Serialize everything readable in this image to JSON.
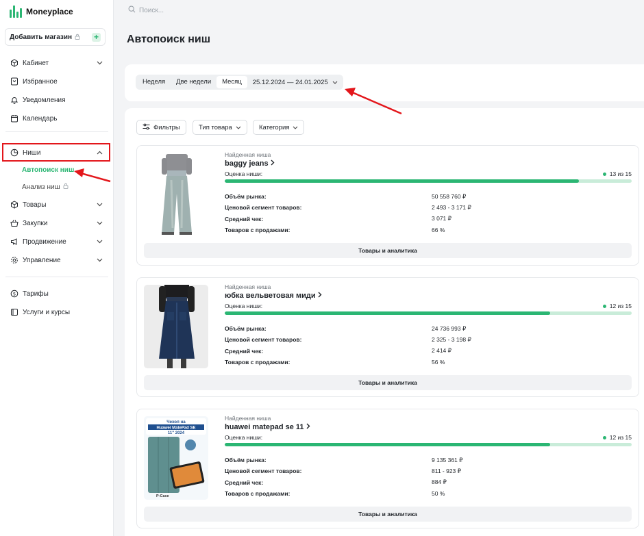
{
  "app": {
    "name": "Moneyplace"
  },
  "sidebar": {
    "add_store": "Добавить магазин",
    "items_top": [
      "Кабинет",
      "Избранное",
      "Уведомления",
      "Календарь"
    ],
    "niches": {
      "label": "Ниши",
      "sub": [
        "Автопоиск ниш",
        "Анализ ниш"
      ]
    },
    "items_mid": [
      "Товары",
      "Закупки",
      "Продвижение",
      "Управление"
    ],
    "items_bottom": [
      "Тарифы",
      "Услуги и курсы"
    ]
  },
  "search": {
    "placeholder": "Поиск..."
  },
  "page": {
    "title": "Автопоиск ниш"
  },
  "period": {
    "options": [
      "Неделя",
      "Две недели",
      "Месяц"
    ],
    "selected": "Месяц",
    "date_range": "25.12.2024 — 24.01.2025"
  },
  "filters": [
    "Фильтры",
    "Тип товара",
    "Категория"
  ],
  "card_labels": {
    "caption": "Найденная ниша",
    "score": "Оценка ниши:",
    "market": "Объём рынка:",
    "price_segment": "Ценовой сегмент товаров:",
    "avg_check": "Средний чек:",
    "with_sales": "Товаров с продажами:",
    "action": "Товары и аналитика"
  },
  "cards": [
    {
      "name": "baggy jeans",
      "score": "13 из 15",
      "score_fraction": 0.87,
      "market": "50 558 760 ₽",
      "price_segment": "2 493 - 3 171 ₽",
      "avg_check": "3 071 ₽",
      "with_sales": "66 %"
    },
    {
      "name": "юбка вельветовая миди",
      "score": "12 из 15",
      "score_fraction": 0.8,
      "market": "24 736 993 ₽",
      "price_segment": "2 325 - 3 198 ₽",
      "avg_check": "2 414 ₽",
      "with_sales": "56 %"
    },
    {
      "name": "huawei matepad se 11",
      "score": "12 из 15",
      "score_fraction": 0.8,
      "market": "9 135 361 ₽",
      "price_segment": "811 - 923 ₽",
      "avg_check": "884 ₽",
      "with_sales": "50 %"
    }
  ],
  "product_image_3": {
    "line1": "Чехол на",
    "line2": "Huawei MatePad SE",
    "line3": "11\" 2024",
    "brand": "P-Case"
  },
  "colors": {
    "accent": "#2bb673",
    "annotation": "#e3161b"
  }
}
